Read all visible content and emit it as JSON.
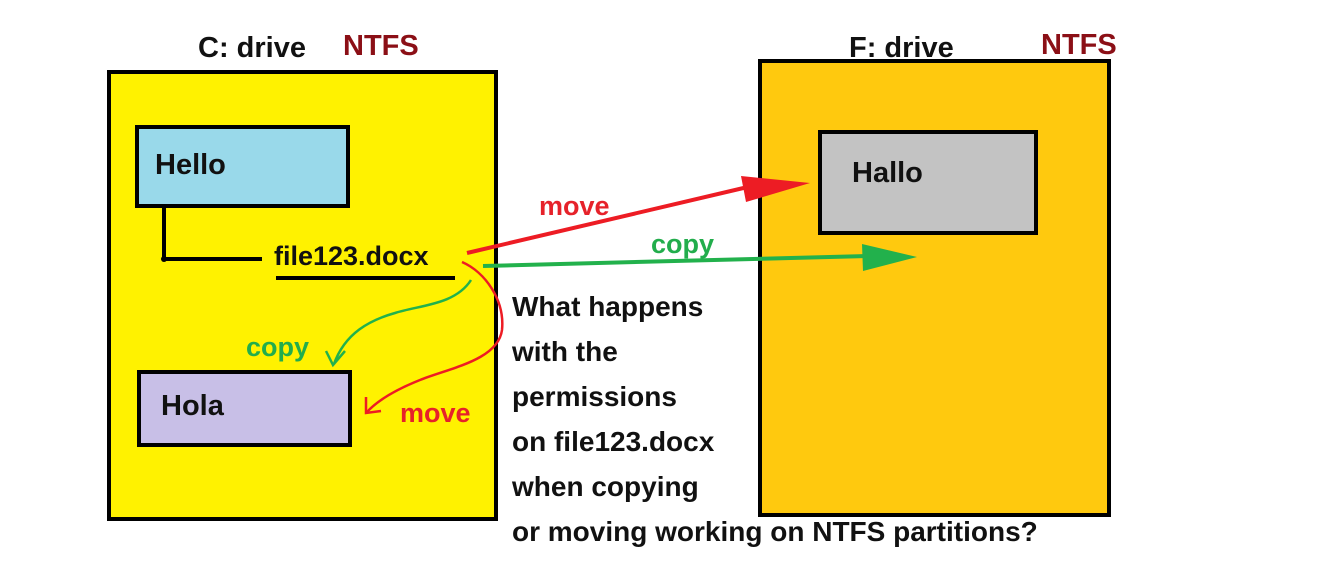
{
  "drive_c": {
    "label": "C:  drive",
    "filesystem": "NTFS",
    "color": "#fff200",
    "folders": {
      "hello": {
        "label": "Hello",
        "color": "#99d9ea"
      },
      "hola": {
        "label": "Hola",
        "color": "#c8bfe7"
      }
    },
    "file": {
      "label": "file123.docx"
    }
  },
  "drive_f": {
    "label": "F:  drive",
    "filesystem": "NTFS",
    "color": "#ffc90e",
    "folders": {
      "hallo": {
        "label": "Hallo",
        "color": "#c3c3c3"
      }
    }
  },
  "arrows": {
    "move_to_f": "move",
    "copy_to_f": "copy",
    "copy_local": "copy",
    "move_local": "move",
    "move_color": "#ed1c24",
    "copy_color": "#22b14c"
  },
  "question": {
    "lines": [
      "What happens",
      "with the",
      "permissions",
      "on file123.docx",
      "when copying",
      "or moving working on NTFS partitions?"
    ]
  }
}
